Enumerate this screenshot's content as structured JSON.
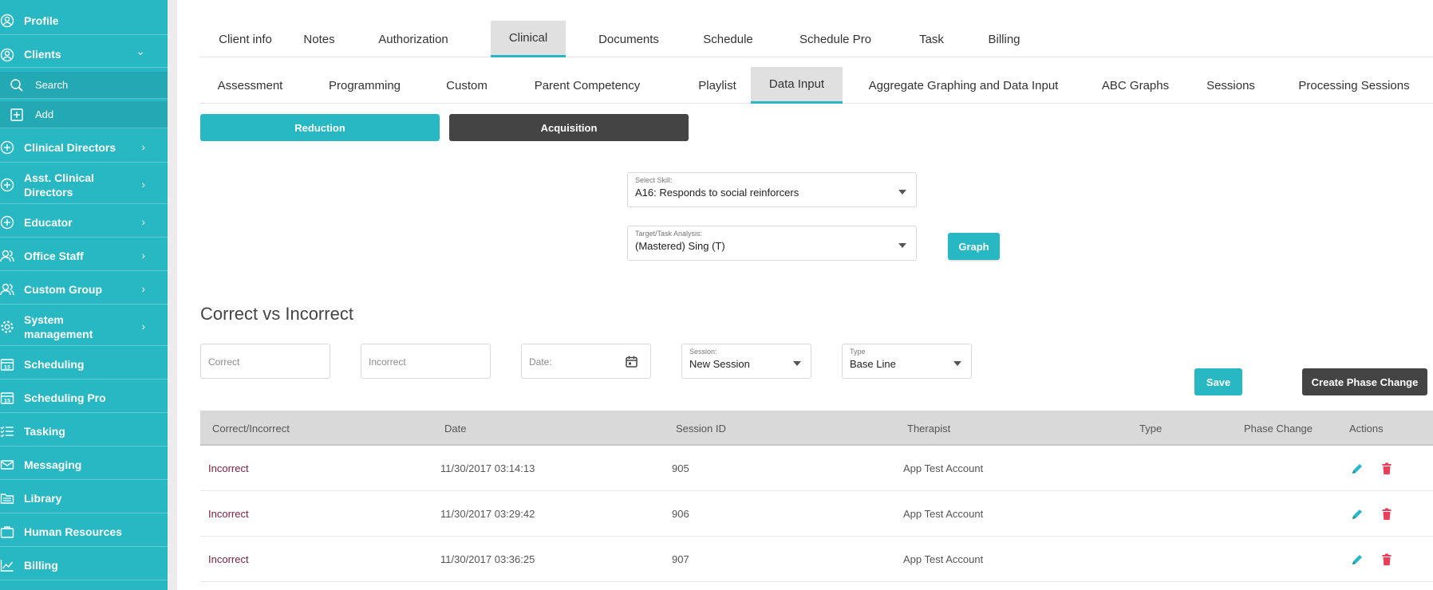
{
  "sidebar": {
    "items": [
      {
        "label": "Profile",
        "icon": "user-circle-icon",
        "chevron": ""
      },
      {
        "label": "Clients",
        "icon": "user-circle-icon",
        "chevron": "⌄"
      },
      {
        "label": "Search",
        "icon": "search-icon",
        "chevron": ""
      },
      {
        "label": "Add",
        "icon": "plus-square-icon",
        "chevron": ""
      },
      {
        "label": "Clinical Directors",
        "icon": "plus-circle-icon",
        "chevron": "›"
      },
      {
        "label": "Asst. Clinical Directors",
        "icon": "plus-circle-icon",
        "chevron": "›"
      },
      {
        "label": "Educator",
        "icon": "plus-circle-icon",
        "chevron": "›"
      },
      {
        "label": "Office Staff",
        "icon": "users-icon",
        "chevron": "›"
      },
      {
        "label": "Custom Group",
        "icon": "users-icon",
        "chevron": "›"
      },
      {
        "label": "System management",
        "icon": "gear-icon",
        "chevron": "›"
      },
      {
        "label": "Scheduling",
        "icon": "calendar-icon",
        "chevron": ""
      },
      {
        "label": "Scheduling Pro",
        "icon": "calendar-icon",
        "chevron": ""
      },
      {
        "label": "Tasking",
        "icon": "list-icon",
        "chevron": ""
      },
      {
        "label": "Messaging",
        "icon": "envelope-icon",
        "chevron": ""
      },
      {
        "label": "Library",
        "icon": "folder-icon",
        "chevron": ""
      },
      {
        "label": "Human Resources",
        "icon": "briefcase-icon",
        "chevron": ""
      },
      {
        "label": "Billing",
        "icon": "chart-icon",
        "chevron": ""
      }
    ]
  },
  "tabs_primary": [
    "Client info",
    "Notes",
    "Authorization",
    "Clinical",
    "Documents",
    "Schedule",
    "Schedule Pro",
    "Task",
    "Billing"
  ],
  "tabs_primary_active": "Clinical",
  "tabs_secondary": [
    "Assessment",
    "Programming",
    "Custom",
    "Parent Competency",
    "Playlist",
    "Data Input",
    "Aggregate Graphing and Data Input",
    "ABC Graphs",
    "Sessions",
    "Processing Sessions"
  ],
  "tabs_secondary_active": "Data Input",
  "mode_buttons": {
    "reduction": "Reduction",
    "acquisition": "Acquisition"
  },
  "select_skill": {
    "label": "Select Skill:",
    "value": "A16: Responds to social reinforcers"
  },
  "target": {
    "label": "Target/Task Analysis:",
    "value": "(Mastered) Sing (T)"
  },
  "graph_button": "Graph",
  "section_title": "Correct vs Incorrect",
  "form": {
    "correct_placeholder": "Correct",
    "incorrect_placeholder": "Incorrect",
    "date_placeholder": "Date:",
    "session": {
      "label": "Session:",
      "value": "New Session"
    },
    "type": {
      "label": "Type",
      "value": "Base Line"
    },
    "save": "Save",
    "create_phase_change": "Create Phase Change"
  },
  "table": {
    "headers": [
      "Correct/Incorrect",
      "Date",
      "Session ID",
      "Therapist",
      "Type",
      "Phase Change",
      "Actions"
    ],
    "rows": [
      {
        "result": "Incorrect",
        "date": "11/30/2017 03:14:13",
        "session_id": "905",
        "therapist": "App Test Account",
        "type": "",
        "phase_change": ""
      },
      {
        "result": "Incorrect",
        "date": "11/30/2017 03:29:42",
        "session_id": "906",
        "therapist": "App Test Account",
        "type": "",
        "phase_change": ""
      },
      {
        "result": "Incorrect",
        "date": "11/30/2017 03:36:25",
        "session_id": "907",
        "therapist": "App Test Account",
        "type": "",
        "phase_change": ""
      }
    ]
  },
  "colors": {
    "accent": "#27b8c4",
    "dark_button": "#444444",
    "delete": "#e8405a",
    "edit": "#27b8c4"
  }
}
